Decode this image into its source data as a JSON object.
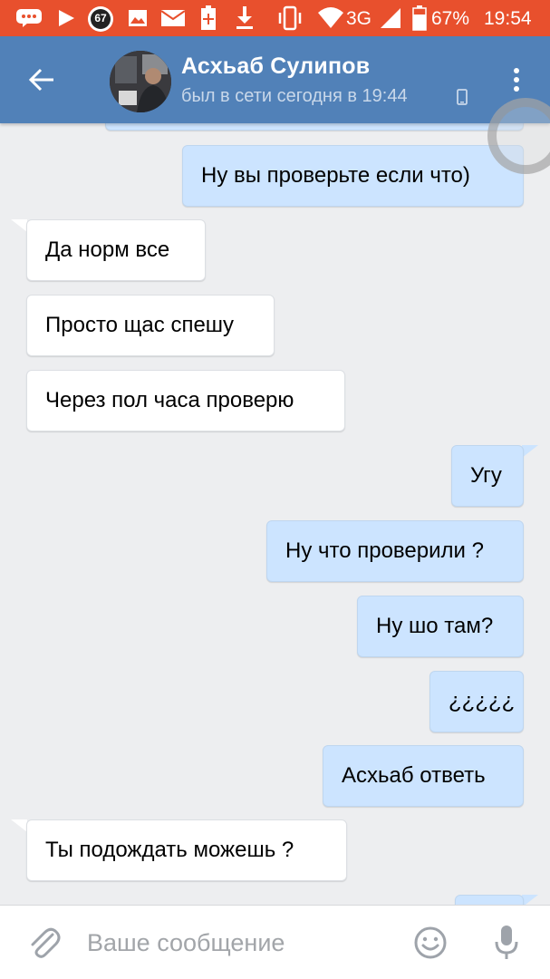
{
  "status_bar": {
    "notification_badge": "67",
    "network": "3G",
    "battery": "67%",
    "time": "19:54",
    "icons": [
      "chat-icon",
      "play-icon",
      "badge-icon",
      "image-icon",
      "mail-icon",
      "battery-plus-icon",
      "download-icon",
      "vibrate-icon",
      "wifi-icon",
      "signal-icon",
      "battery-icon"
    ]
  },
  "header": {
    "contact_name": "Асхьаб Сулипов",
    "contact_status": "был в сети сегодня в 19:44",
    "icons": [
      "back-arrow-icon",
      "avatar",
      "phone-icon",
      "more-vert-icon"
    ]
  },
  "messages": [
    {
      "direction": "out",
      "text": "Ну вы проверьте если что)"
    },
    {
      "direction": "in",
      "text": "Да норм все"
    },
    {
      "direction": "in",
      "text": "Просто щас спешу"
    },
    {
      "direction": "in",
      "text": "Через пол часа проверю"
    },
    {
      "direction": "out",
      "text": "Угу"
    },
    {
      "direction": "out",
      "text": "Ну что проверили ?"
    },
    {
      "direction": "out",
      "text": "Ну шо там?"
    },
    {
      "direction": "out",
      "text": "¿¿¿¿¿"
    },
    {
      "direction": "out",
      "text": "Асхьаб ответь"
    },
    {
      "direction": "in",
      "text": "Ты подождать можешь ?"
    }
  ],
  "compose": {
    "placeholder": "Ваше сообщение",
    "icons": [
      "paperclip-icon",
      "emoji-icon",
      "microphone-icon"
    ]
  },
  "colors": {
    "status_bar": "#e8502d",
    "header": "#5181b8",
    "background": "#edeef0",
    "outgoing_bubble": "#cce4ff",
    "incoming_bubble": "#ffffff"
  }
}
